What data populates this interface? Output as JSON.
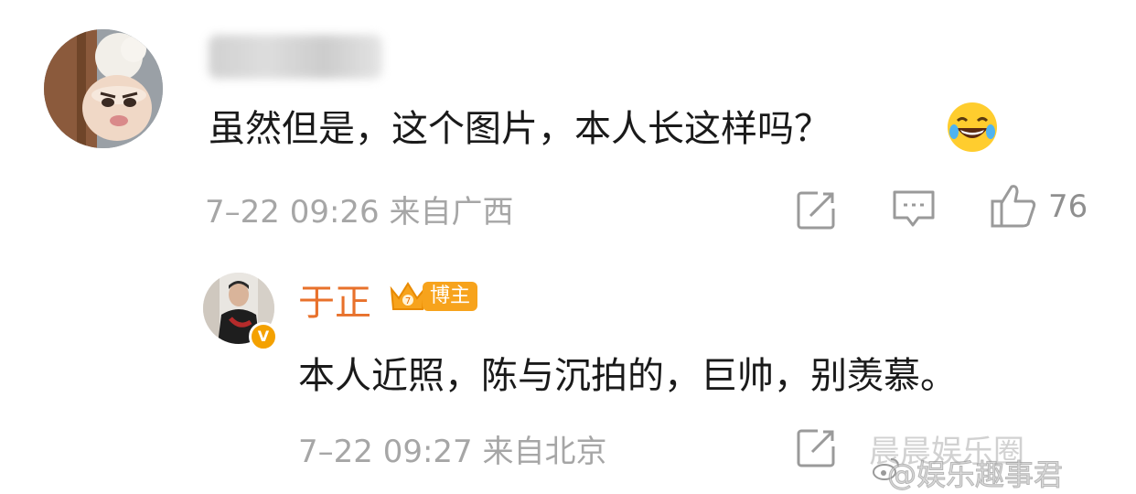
{
  "comment": {
    "text": "虽然但是，这个图片，本人长这样吗？",
    "time": "7–22 09:26",
    "location": "来自广西",
    "likes": "76",
    "emoji_icon": "laughing-tears-emoji"
  },
  "reply": {
    "author": "于正",
    "badge_label": "博主",
    "text": "本人近照，陈与沉拍的，巨帅，别羡慕。",
    "time": "7–22 09:27",
    "location": "来自北京",
    "verified_icon": "v-verified-badge"
  },
  "watermark": {
    "line1": "晨晨娱乐圈",
    "line2": "@娱乐趣事君"
  },
  "colors": {
    "author": "#e8712b",
    "badge": "#f7a31c",
    "meta": "#a6a6a6",
    "text": "#1a1a1a"
  }
}
